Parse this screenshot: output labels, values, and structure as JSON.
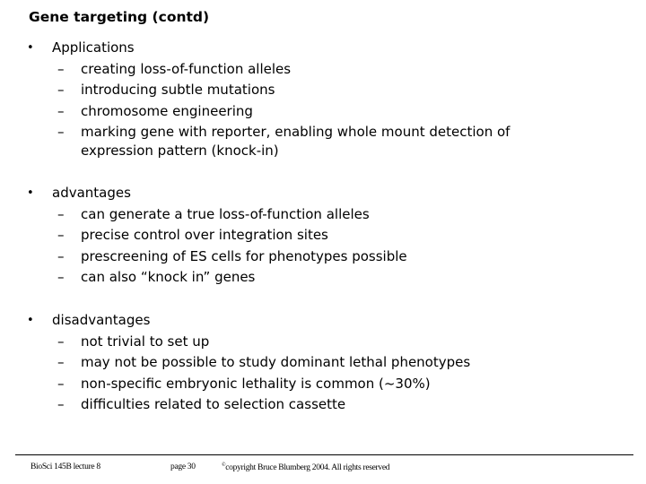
{
  "slide": {
    "title": "Gene targeting (contd)",
    "sections": [
      {
        "label": "Applications",
        "items": [
          "creating loss-of-function alleles",
          "introducing subtle mutations",
          "chromosome engineering",
          "marking gene with reporter, enabling whole mount detection of expression pattern (knock-in)"
        ]
      },
      {
        "label": "advantages",
        "items": [
          "can generate a true loss-of-function alleles",
          "precise control over integration sites",
          "prescreening of ES cells for phenotypes possible",
          "can also “knock in” genes"
        ]
      },
      {
        "label": "disadvantages",
        "items": [
          "not trivial to set up",
          "may not be possible to study dominant lethal phenotypes",
          "non-specific embryonic lethality is common (~30%)",
          "difficulties related to selection cassette"
        ]
      }
    ],
    "bullet_glyph": "•",
    "dash_glyph": "–"
  },
  "footer": {
    "course": "BioSci 145B lecture 8",
    "page": "page 30",
    "copyright_symbol": "©",
    "copyright": "copyright Bruce Blumberg 2004. All rights reserved"
  }
}
